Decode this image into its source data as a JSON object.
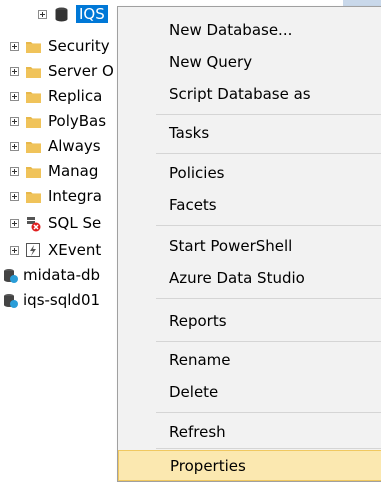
{
  "tree": {
    "items": [
      {
        "label": "IQS",
        "icon": "database-icon",
        "expander": true,
        "selected": true
      },
      {
        "label": "Security",
        "icon": "folder-icon",
        "expander": true
      },
      {
        "label": "Server O",
        "icon": "folder-icon",
        "expander": true
      },
      {
        "label": "Replica",
        "icon": "folder-icon",
        "expander": true
      },
      {
        "label": "PolyBas",
        "icon": "folder-icon",
        "expander": true
      },
      {
        "label": "Always",
        "icon": "folder-icon",
        "expander": true
      },
      {
        "label": "Manag",
        "icon": "folder-icon",
        "expander": true
      },
      {
        "label": "Integra",
        "icon": "folder-icon",
        "expander": true
      },
      {
        "label": "SQL Se",
        "icon": "sql-agent-icon",
        "expander": true
      },
      {
        "label": "XEvent",
        "icon": "xevent-icon",
        "expander": true
      },
      {
        "label": "midata-db",
        "icon": "server-icon",
        "expander": false
      },
      {
        "label": "iqs-sqld01",
        "icon": "server-icon",
        "expander": false
      }
    ]
  },
  "context_menu": {
    "items": [
      {
        "label": "New Database..."
      },
      {
        "label": "New Query"
      },
      {
        "label": "Script Database as"
      },
      {
        "label": "Tasks"
      },
      {
        "label": "Policies"
      },
      {
        "label": "Facets"
      },
      {
        "label": "Start PowerShell"
      },
      {
        "label": "Azure Data Studio"
      },
      {
        "label": "Reports"
      },
      {
        "label": "Rename"
      },
      {
        "label": "Delete"
      },
      {
        "label": "Refresh"
      },
      {
        "label": "Properties",
        "highlighted": true
      }
    ]
  },
  "colors": {
    "selection": "#0078d7",
    "menu_background": "#f2f2f2",
    "menu_highlight": "#fbe8b0",
    "folder": "#e8b84a"
  }
}
